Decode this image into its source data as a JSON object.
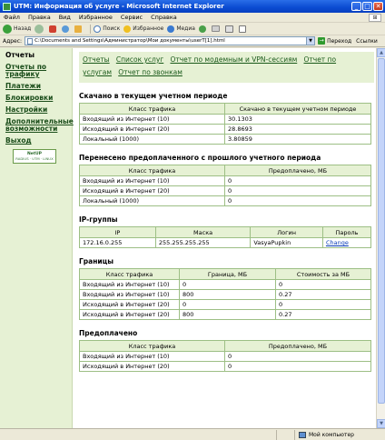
{
  "window": {
    "title": "UTM: Информация об услуге - Microsoft Internet Explorer",
    "controls": [
      "_",
      "□",
      "✕"
    ]
  },
  "menu": [
    "Файл",
    "Правка",
    "Вид",
    "Избранное",
    "Сервис",
    "Справка"
  ],
  "toolbar": {
    "back": "Назад",
    "search": "Поиск",
    "favorites": "Избранное",
    "media": "Медиа"
  },
  "address": {
    "label": "Адрес:",
    "url": "C:\\Documents and Settings\\Администратор\\Мои документы\\userT[1].html",
    "go": "Переход",
    "links": "Ссылки"
  },
  "leftnav": {
    "items": [
      "Отчеты",
      "Отчеты по трафику",
      "Платежи",
      "Блокировки",
      "Настройки",
      "Дополнительные возможности",
      "Выход"
    ],
    "logo_top": "NetUP",
    "logo_bottom": "RADIUS · UTM · LINUX"
  },
  "topnav": [
    "Отчеты",
    "Список услуг",
    "Отчет по модемным и VPN-сессиям",
    "Отчет по услугам",
    "Отчет по звонкам"
  ],
  "traffic": {
    "title": "Скачано в текущем учетном периоде",
    "headers": [
      "Класс трафика",
      "Скачано в текущем учетном периоде"
    ],
    "rows": [
      [
        "Входящий из Интернет (10)",
        "30.1303"
      ],
      [
        "Исходящий в Интернет (20)",
        "28.8693"
      ],
      [
        "Локальный (1000)",
        "3.80859"
      ]
    ]
  },
  "prepaid_moved": {
    "title": "Перенесено предоплаченного с прошлого учетного периода",
    "headers": [
      "Класс трафика",
      "Предоплачено, МБ"
    ],
    "rows": [
      [
        "Входящий из Интернет (10)",
        "0"
      ],
      [
        "Исходящий в Интернет (20)",
        "0"
      ],
      [
        "Локальный (1000)",
        "0"
      ]
    ]
  },
  "ip_groups": {
    "title": "IP-группы",
    "headers": [
      "IP",
      "Маска",
      "Логин",
      "Пароль"
    ],
    "row": [
      "172.16.0.255",
      "255.255.255.255",
      "VasyaPupkin",
      "Change"
    ]
  },
  "limits": {
    "title": "Границы",
    "headers": [
      "Класс трафика",
      "Граница, МБ",
      "Стоимость за МБ"
    ],
    "rows": [
      [
        "Входящий из Интернет (10)",
        "0",
        "0"
      ],
      [
        "Входящий из Интернет (10)",
        "800",
        "0.27"
      ],
      [
        "Исходящий в Интернет (20)",
        "0",
        "0"
      ],
      [
        "Исходящий в Интернет (20)",
        "800",
        "0.27"
      ]
    ]
  },
  "prepaid": {
    "title": "Предоплачено",
    "headers": [
      "Класс трафика",
      "Предоплачено, МБ"
    ],
    "rows": [
      [
        "Входящий из Интернет (10)",
        "0"
      ],
      [
        "Исходящий в Интернет (20)",
        "0"
      ]
    ]
  },
  "status": {
    "zone": "Мой компьютер"
  }
}
